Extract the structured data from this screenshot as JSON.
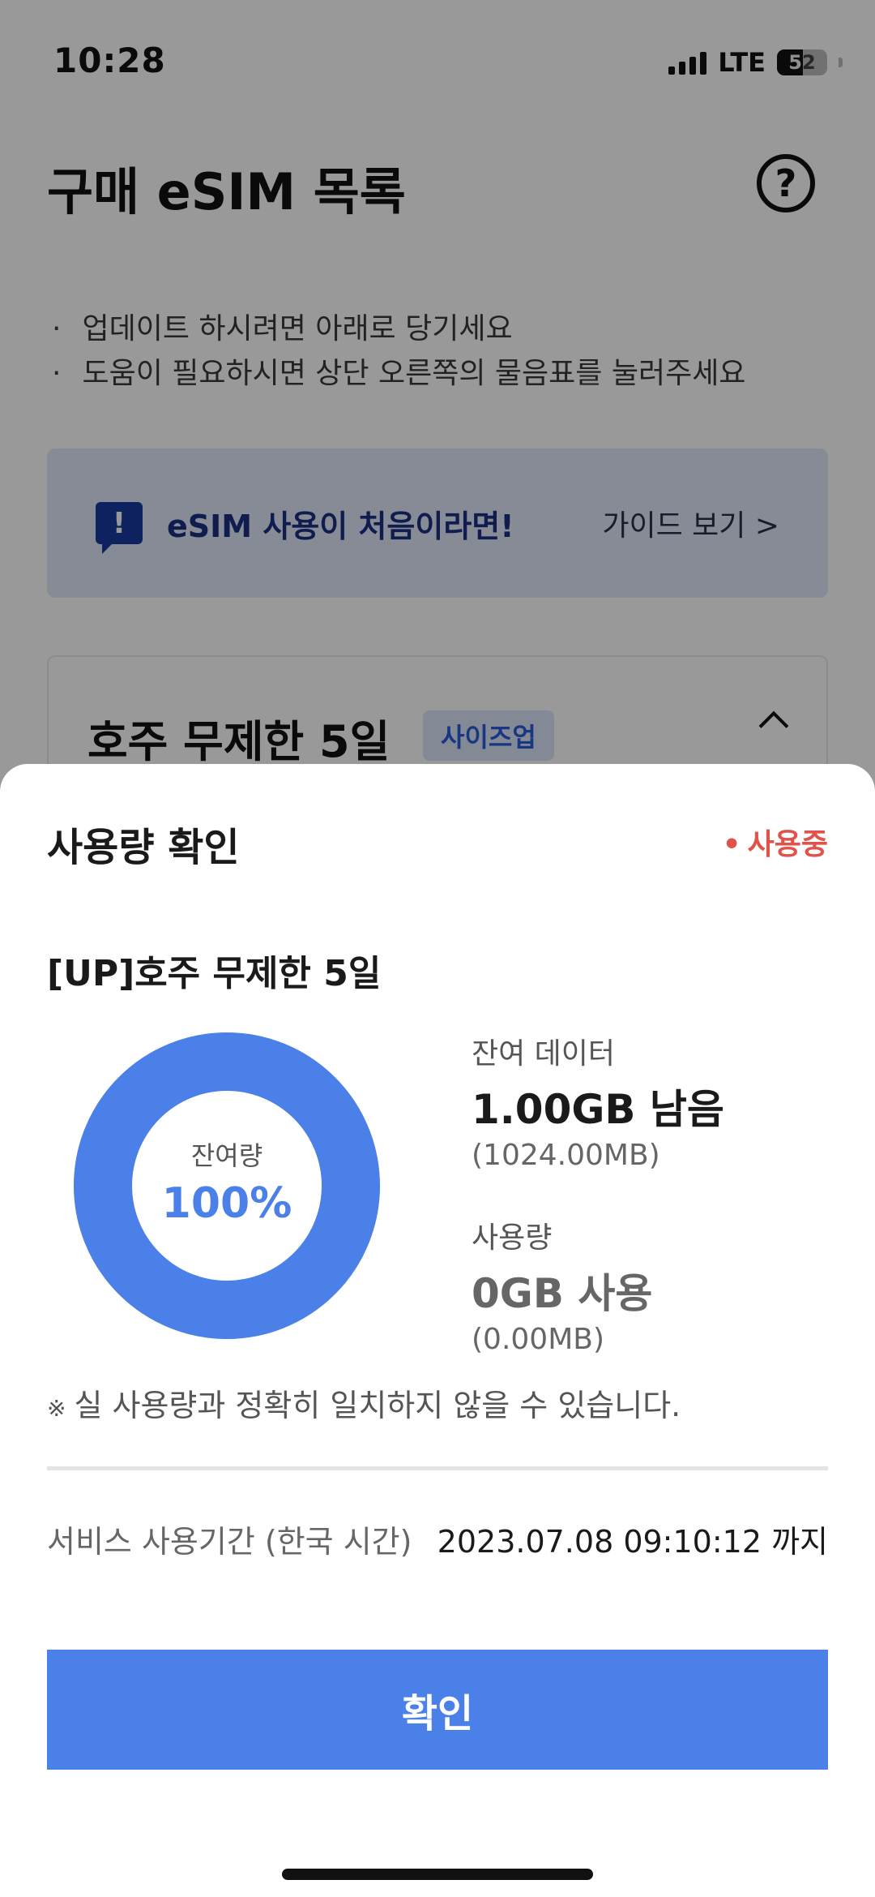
{
  "status_bar": {
    "time": "10:28",
    "network": "LTE",
    "battery": "52",
    "battery_level": 0.52
  },
  "header": {
    "title": "구매 eSIM 목록",
    "help_icon": "question-circle-icon",
    "help_glyph": "?"
  },
  "hints": [
    "업데이트 하시려면 아래로 당기세요",
    "도움이 필요하시면 상단 오른쪽의 물음표를 눌러주세요"
  ],
  "guide_banner": {
    "icon": "exclamation-chat-icon",
    "icon_glyph": "!",
    "title": "eSIM 사용이 처음이라면!",
    "link": "가이드 보기 >"
  },
  "product_card": {
    "name": "호주 무제한 5일",
    "tag": "사이즈업",
    "chevron_icon": "chevron-up-icon"
  },
  "sheet": {
    "title": "사용량 확인",
    "status": "사용중",
    "plan_name": "[UP]호주 무제한 5일",
    "donut": {
      "label": "잔여량",
      "value": "100%",
      "remaining_fraction": 1.0
    },
    "remaining": {
      "label": "잔여 데이터",
      "main": "1.00GB 남음",
      "sub": "(1024.00MB)"
    },
    "used": {
      "label": "사용량",
      "main": "0GB 사용",
      "sub": "(0.00MB)"
    },
    "notice_mark": "※",
    "notice": "실 사용량과 정확히 일치하지 않을 수 있습니다.",
    "period_label": "서비스 사용기간 (한국 시간)",
    "period_value": "2023.07.08 09:10:12 까지",
    "confirm": "확인"
  },
  "colors": {
    "accent": "#4a80e8",
    "status_active": "#e0524a",
    "banner_bg": "#dfe8fb"
  }
}
